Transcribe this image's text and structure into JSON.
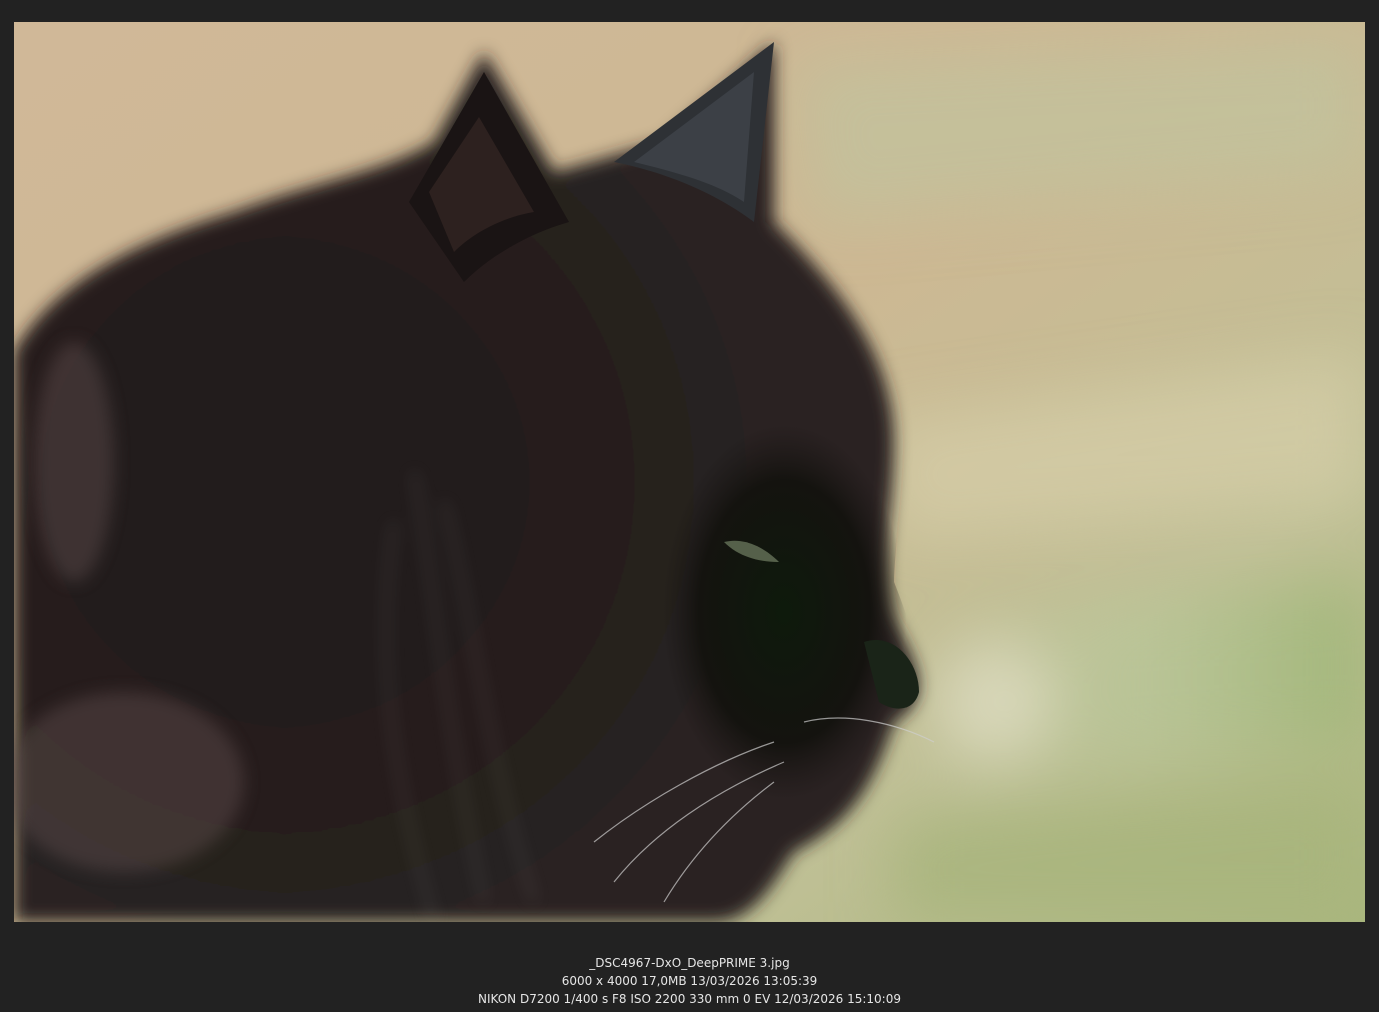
{
  "photo": {
    "subject": "black long-haired cat in profile, eyes half closed, blurred beige and green background"
  },
  "info": {
    "filename": "_DSC4967-DxO_DeepPRIME 3.jpg",
    "file_details": "6000 x 4000  17,0MB  13/03/2026 13:05:39",
    "exif": "NIKON D7200  1/400 s  F8  ISO 2200  330 mm  0 EV  12/03/2026 15:10:09"
  },
  "colors": {
    "window_background": "#222222",
    "text": "#e6e6e6"
  }
}
